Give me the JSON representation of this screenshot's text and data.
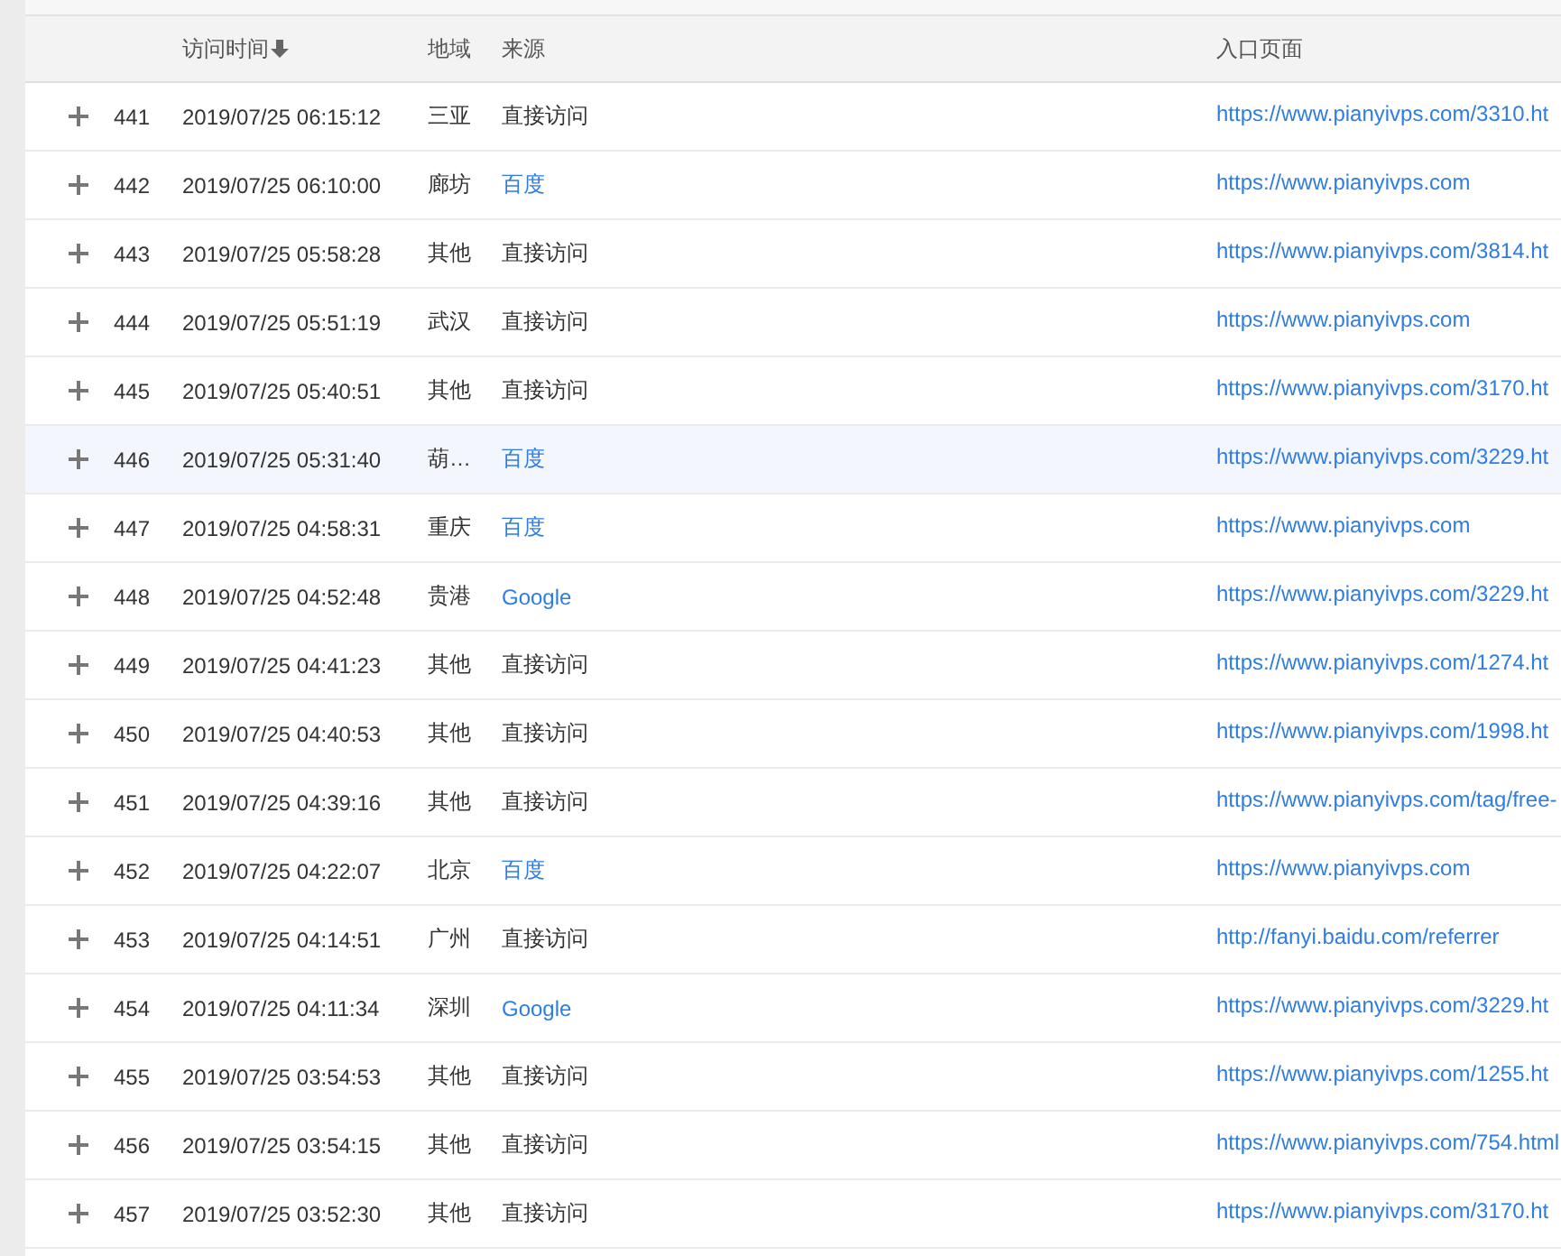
{
  "table": {
    "columns": [
      {
        "label": "访问时间",
        "sorted": true
      },
      {
        "label": "地域",
        "sorted": false
      },
      {
        "label": "来源",
        "sorted": false
      },
      {
        "label": "入口页面",
        "sorted": false
      }
    ],
    "rows": [
      {
        "number": "441",
        "time": "2019/07/25 06:15:12",
        "region": "三亚",
        "source": "直接访问",
        "source_is_link": false,
        "entry_page": "https://www.pianyivps.com/3310.ht",
        "highlighted": false
      },
      {
        "number": "442",
        "time": "2019/07/25 06:10:00",
        "region": "廊坊",
        "source": "百度",
        "source_is_link": true,
        "entry_page": "https://www.pianyivps.com",
        "highlighted": false
      },
      {
        "number": "443",
        "time": "2019/07/25 05:58:28",
        "region": "其他",
        "source": "直接访问",
        "source_is_link": false,
        "entry_page": "https://www.pianyivps.com/3814.ht",
        "highlighted": false
      },
      {
        "number": "444",
        "time": "2019/07/25 05:51:19",
        "region": "武汉",
        "source": "直接访问",
        "source_is_link": false,
        "entry_page": "https://www.pianyivps.com",
        "highlighted": false
      },
      {
        "number": "445",
        "time": "2019/07/25 05:40:51",
        "region": "其他",
        "source": "直接访问",
        "source_is_link": false,
        "entry_page": "https://www.pianyivps.com/3170.ht",
        "highlighted": false
      },
      {
        "number": "446",
        "time": "2019/07/25 05:31:40",
        "region": "葫…",
        "source": "百度",
        "source_is_link": true,
        "entry_page": "https://www.pianyivps.com/3229.ht",
        "highlighted": true
      },
      {
        "number": "447",
        "time": "2019/07/25 04:58:31",
        "region": "重庆",
        "source": "百度",
        "source_is_link": true,
        "entry_page": "https://www.pianyivps.com",
        "highlighted": false
      },
      {
        "number": "448",
        "time": "2019/07/25 04:52:48",
        "region": "贵港",
        "source": "Google",
        "source_is_link": true,
        "entry_page": "https://www.pianyivps.com/3229.ht",
        "highlighted": false
      },
      {
        "number": "449",
        "time": "2019/07/25 04:41:23",
        "region": "其他",
        "source": "直接访问",
        "source_is_link": false,
        "entry_page": "https://www.pianyivps.com/1274.ht",
        "highlighted": false
      },
      {
        "number": "450",
        "time": "2019/07/25 04:40:53",
        "region": "其他",
        "source": "直接访问",
        "source_is_link": false,
        "entry_page": "https://www.pianyivps.com/1998.ht",
        "highlighted": false
      },
      {
        "number": "451",
        "time": "2019/07/25 04:39:16",
        "region": "其他",
        "source": "直接访问",
        "source_is_link": false,
        "entry_page": "https://www.pianyivps.com/tag/free-",
        "highlighted": false
      },
      {
        "number": "452",
        "time": "2019/07/25 04:22:07",
        "region": "北京",
        "source": "百度",
        "source_is_link": true,
        "entry_page": "https://www.pianyivps.com",
        "highlighted": false
      },
      {
        "number": "453",
        "time": "2019/07/25 04:14:51",
        "region": "广州",
        "source": "直接访问",
        "source_is_link": false,
        "entry_page": "http://fanyi.baidu.com/referrer",
        "highlighted": false
      },
      {
        "number": "454",
        "time": "2019/07/25 04:11:34",
        "region": "深圳",
        "source": "Google",
        "source_is_link": true,
        "entry_page": "https://www.pianyivps.com/3229.ht",
        "highlighted": false
      },
      {
        "number": "455",
        "time": "2019/07/25 03:54:53",
        "region": "其他",
        "source": "直接访问",
        "source_is_link": false,
        "entry_page": "https://www.pianyivps.com/1255.ht",
        "highlighted": false
      },
      {
        "number": "456",
        "time": "2019/07/25 03:54:15",
        "region": "其他",
        "source": "直接访问",
        "source_is_link": false,
        "entry_page": "https://www.pianyivps.com/754.html",
        "highlighted": false
      },
      {
        "number": "457",
        "time": "2019/07/25 03:52:30",
        "region": "其他",
        "source": "直接访问",
        "source_is_link": false,
        "entry_page": "https://www.pianyivps.com/3170.ht",
        "highlighted": false
      }
    ]
  }
}
